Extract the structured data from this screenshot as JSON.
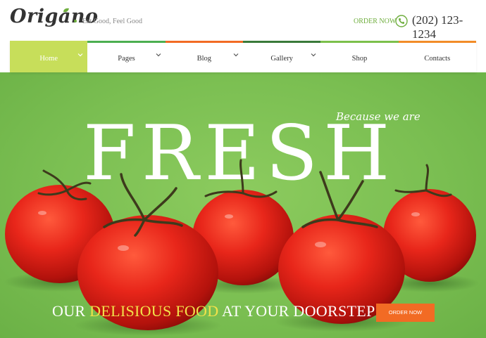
{
  "header": {
    "logo_text": "Origano",
    "tagline": "Eat Good, Feel Good",
    "order_link": "ORDER NOW",
    "phone": "(202) 123-1234"
  },
  "nav": {
    "items": [
      {
        "label": "Home",
        "active": true,
        "has_dropdown": true,
        "color": "#c7de5a"
      },
      {
        "label": "Pages",
        "has_dropdown": true,
        "color": "#4caf50"
      },
      {
        "label": "Blog",
        "has_dropdown": true,
        "color": "#f26b24"
      },
      {
        "label": "Gallery",
        "has_dropdown": true,
        "color": "#3a7a3a"
      },
      {
        "label": "Shop",
        "has_dropdown": false,
        "color": "#7cc04b"
      },
      {
        "label": "Contacts",
        "has_dropdown": false,
        "color": "#f28c28"
      }
    ]
  },
  "hero": {
    "script_text": "Because we are",
    "big_word": "FRESH",
    "headline_part1": "OUR ",
    "headline_accent": "DELISIOUS FOOD",
    "headline_part2": " AT YOUR DOORSTEP!",
    "button_label": "ORDER NOW"
  },
  "colors": {
    "brand_green": "#6fae3e",
    "hero_green": "#7bbf52",
    "accent_yellow": "#f2e24a",
    "cta_orange": "#f26b24"
  },
  "icons": [
    "leaf-icon",
    "phone-icon",
    "chevron-down-icon"
  ]
}
